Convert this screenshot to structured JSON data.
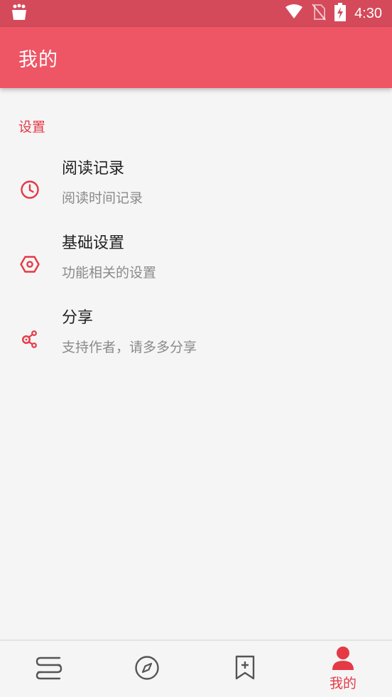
{
  "status_bar": {
    "time": "4:30",
    "icons": [
      "shopping-bag-icon",
      "wifi-icon",
      "no-sim-icon",
      "battery-charging-icon"
    ]
  },
  "app_bar": {
    "title": "我的"
  },
  "settings": {
    "section_title": "设置",
    "items": [
      {
        "title": "阅读记录",
        "subtitle": "阅读时间记录",
        "icon": "clock-icon"
      },
      {
        "title": "基础设置",
        "subtitle": "功能相关的设置",
        "icon": "settings-hexagon-icon"
      },
      {
        "title": "分享",
        "subtitle": "支持作者，请多多分享",
        "icon": "share-icon"
      }
    ]
  },
  "bottom_nav": {
    "items": [
      {
        "icon": "bookshelf-icon",
        "label": ""
      },
      {
        "icon": "compass-icon",
        "label": ""
      },
      {
        "icon": "bookmark-add-icon",
        "label": ""
      },
      {
        "icon": "person-icon",
        "label": "我的",
        "active": true
      }
    ]
  },
  "colors": {
    "status_bar": "#d44a5a",
    "primary": "#ee5666",
    "accent": "#e53946",
    "nav_inactive": "#555555"
  }
}
